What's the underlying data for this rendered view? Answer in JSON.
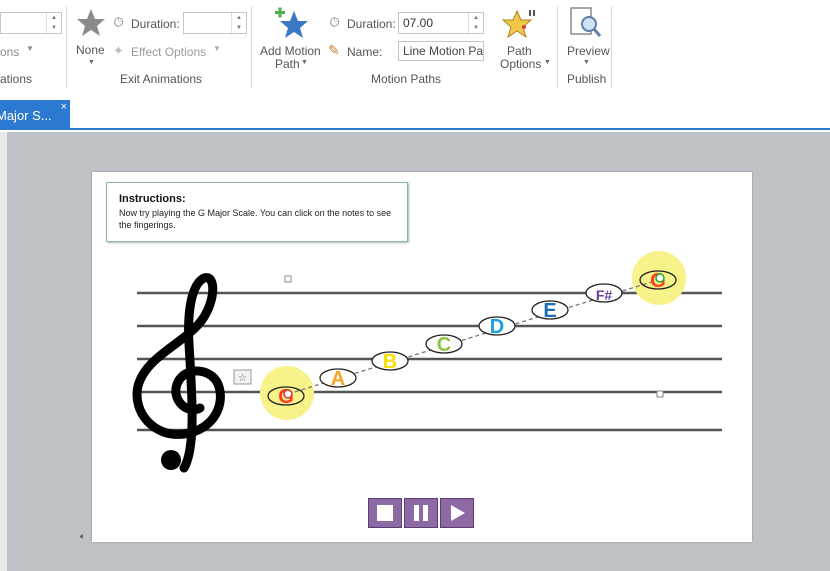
{
  "ribbon": {
    "left_partial": {
      "options_label": "ons",
      "group_label": "ations"
    },
    "exit": {
      "none_label": "None",
      "duration_label": "Duration:",
      "duration_value": "",
      "effect_options_label": "Effect Options",
      "group_label": "Exit Animations"
    },
    "motion": {
      "add_label_1": "Add Motion",
      "add_label_2": "Path",
      "duration_label": "Duration:",
      "duration_value": "07.00",
      "name_label": "Name:",
      "name_value": "Line Motion Pat",
      "path_options_1": "Path",
      "path_options_2": "Options",
      "group_label": "Motion Paths"
    },
    "publish": {
      "preview_label": "Preview",
      "group_label": "Publish"
    }
  },
  "tab": {
    "label": "Major S...",
    "close": "×"
  },
  "slide": {
    "instructions_title": "Instructions:",
    "instructions_body": "Now try playing the G Major Scale. You can click on the notes to see the fingerings.",
    "notes": [
      "G",
      "A",
      "B",
      "C",
      "D",
      "E",
      "F#",
      "G"
    ],
    "note_colors": [
      "#ff3b1f",
      "#f5a623",
      "#f5e000",
      "#8cc63f",
      "#1ba1e2",
      "#1e6eb7",
      "#6a3f9c",
      "#ff3b1f"
    ],
    "controls": [
      "stop",
      "pause",
      "play"
    ]
  },
  "colors": {
    "accent": "#2b79d0",
    "highlight": "#f7f28a",
    "control": "#8e6aa4"
  }
}
